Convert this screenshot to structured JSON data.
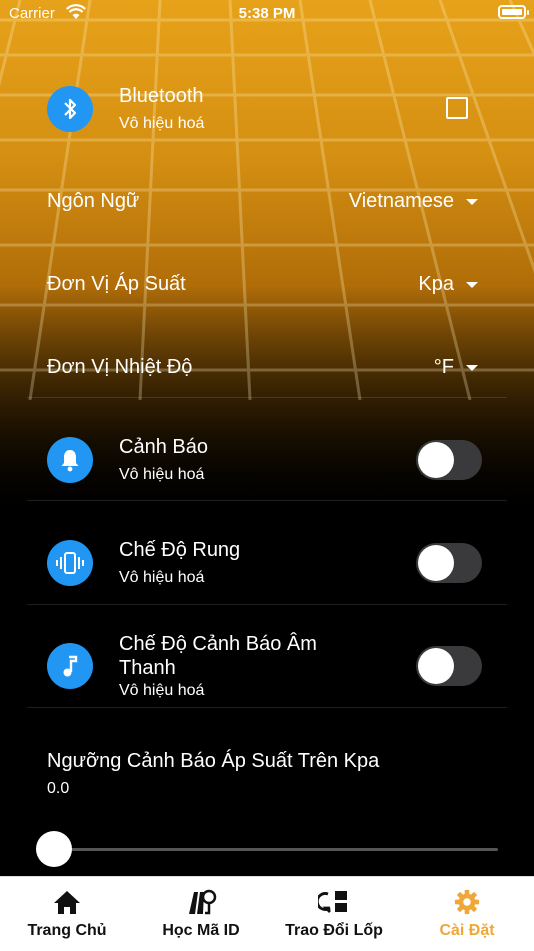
{
  "status_bar": {
    "carrier": "Carrier",
    "time": "5:38 PM"
  },
  "bluetooth": {
    "title": "Bluetooth",
    "subtitle": "Vô hiệu hoá",
    "checked": false
  },
  "language": {
    "label": "Ngôn Ngữ",
    "value": "Vietnamese"
  },
  "pressure_unit": {
    "label": "Đơn Vị Áp Suất",
    "value": "Kpa"
  },
  "temperature_unit": {
    "label": "Đơn Vị Nhiệt Độ",
    "value": "°F"
  },
  "alert": {
    "title": "Cảnh Báo",
    "subtitle": "Vô hiệu hoá",
    "on": false
  },
  "vibration": {
    "title": "Chế Độ Rung",
    "subtitle": "Vô hiệu hoá",
    "on": false
  },
  "sound_alert": {
    "title_line1": "Chế Độ Cảnh Báo Âm",
    "title_line2": "Thanh",
    "subtitle": "Vô hiệu hoá",
    "on": false
  },
  "pressure_threshold": {
    "label": "Ngưỡng Cảnh Báo Áp Suất Trên Kpa",
    "value": "0.0",
    "slider_fraction": 0
  },
  "tabs": [
    {
      "label": "Trang Chủ",
      "icon": "home-icon",
      "active": false
    },
    {
      "label": "Học Mã ID",
      "icon": "learn-id-icon",
      "active": false
    },
    {
      "label": "Trao Đổi Lốp",
      "icon": "swap-tire-icon",
      "active": false
    },
    {
      "label": "Cài Đặt",
      "icon": "settings-icon",
      "active": true
    }
  ],
  "colors": {
    "accent_blue": "#2196f3",
    "active_tab": "#f0a73a",
    "background": "#000000",
    "header_gold": "#e7a21a"
  }
}
